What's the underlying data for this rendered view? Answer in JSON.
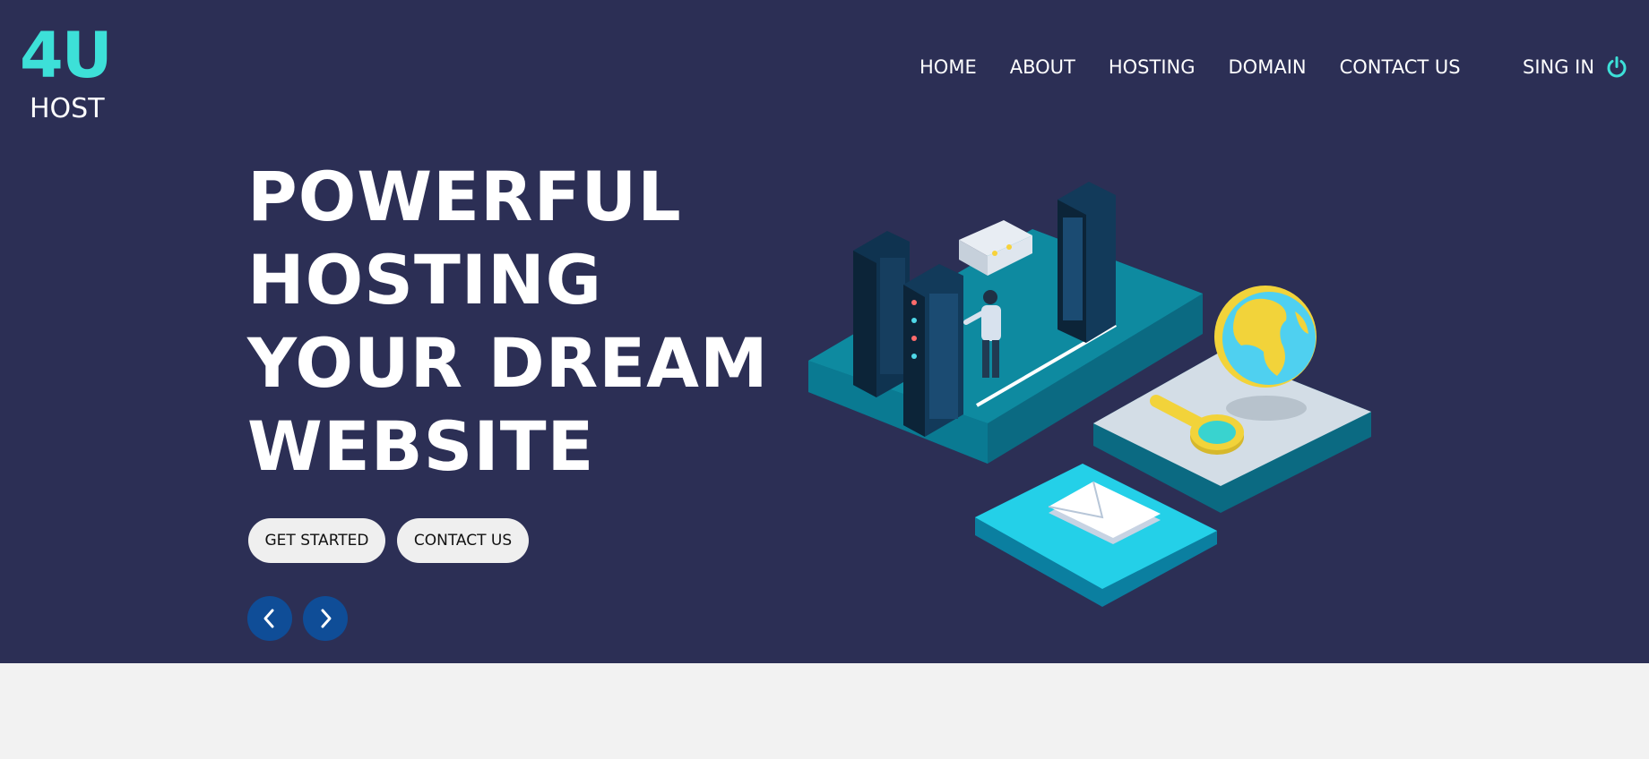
{
  "brand": {
    "mark": "4U",
    "sub": "HOST"
  },
  "nav": {
    "items": [
      {
        "label": "HOME"
      },
      {
        "label": "ABOUT"
      },
      {
        "label": "HOSTING"
      },
      {
        "label": "DOMAIN"
      },
      {
        "label": "CONTACT US"
      }
    ],
    "signin_label": "SING IN",
    "signin_icon": "power-icon"
  },
  "hero": {
    "headline_lines": [
      "POWERFUL",
      "HOSTING",
      "YOUR DREAM",
      "WEBSITE"
    ],
    "primary_button": "GET STARTED",
    "secondary_button": "CONTACT US",
    "prev_icon": "chevron-left-icon",
    "next_icon": "chevron-right-icon",
    "illustration": "isometric-server-room-illustration"
  },
  "colors": {
    "hero_bg": "#2c2f55",
    "accent": "#3de0d8",
    "arrow_bg": "#0f4d97",
    "button_bg": "#efefef",
    "page_bg": "#f2f2f2"
  }
}
